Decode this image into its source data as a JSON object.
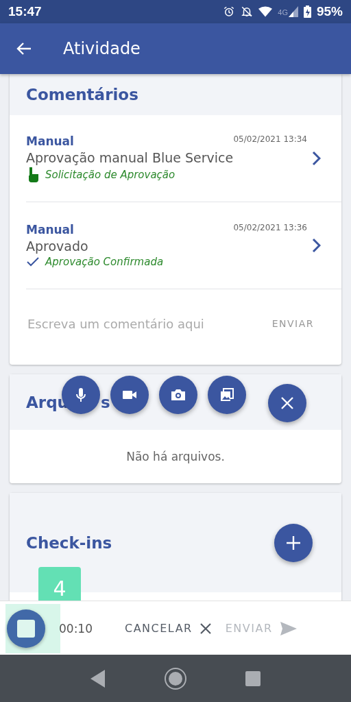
{
  "status_bar": {
    "time": "15:47",
    "network": "4G",
    "battery": "95%"
  },
  "app_bar": {
    "title": "Atividade"
  },
  "comments": {
    "title": "Comentários",
    "items": [
      {
        "kind": "request",
        "author": "Manual",
        "date": "05/02/2021 13:34",
        "text": "Aprovação manual Blue Service",
        "status": "Solicitação de Aprovação"
      },
      {
        "kind": "confirmed",
        "author": "Manual",
        "date": "05/02/2021 13:36",
        "text": "Aprovado",
        "status": "Aprovação Confirmada"
      }
    ],
    "input": {
      "placeholder": "Escreva um comentário aqui",
      "send": "ENVIAR"
    }
  },
  "files": {
    "title_parts": [
      "Arqu",
      "s"
    ],
    "empty": "Não há arquivos."
  },
  "attach_actions": [
    {
      "kind": "mic"
    },
    {
      "kind": "video"
    },
    {
      "kind": "camera"
    },
    {
      "kind": "gallery"
    },
    {
      "kind": "close"
    }
  ],
  "checkins": {
    "title": "Check-ins"
  },
  "counter_badge": "4",
  "recorder": {
    "time": "00:10",
    "cancel": "CANCELAR",
    "send": "ENVIAR",
    "send_disabled": true
  }
}
